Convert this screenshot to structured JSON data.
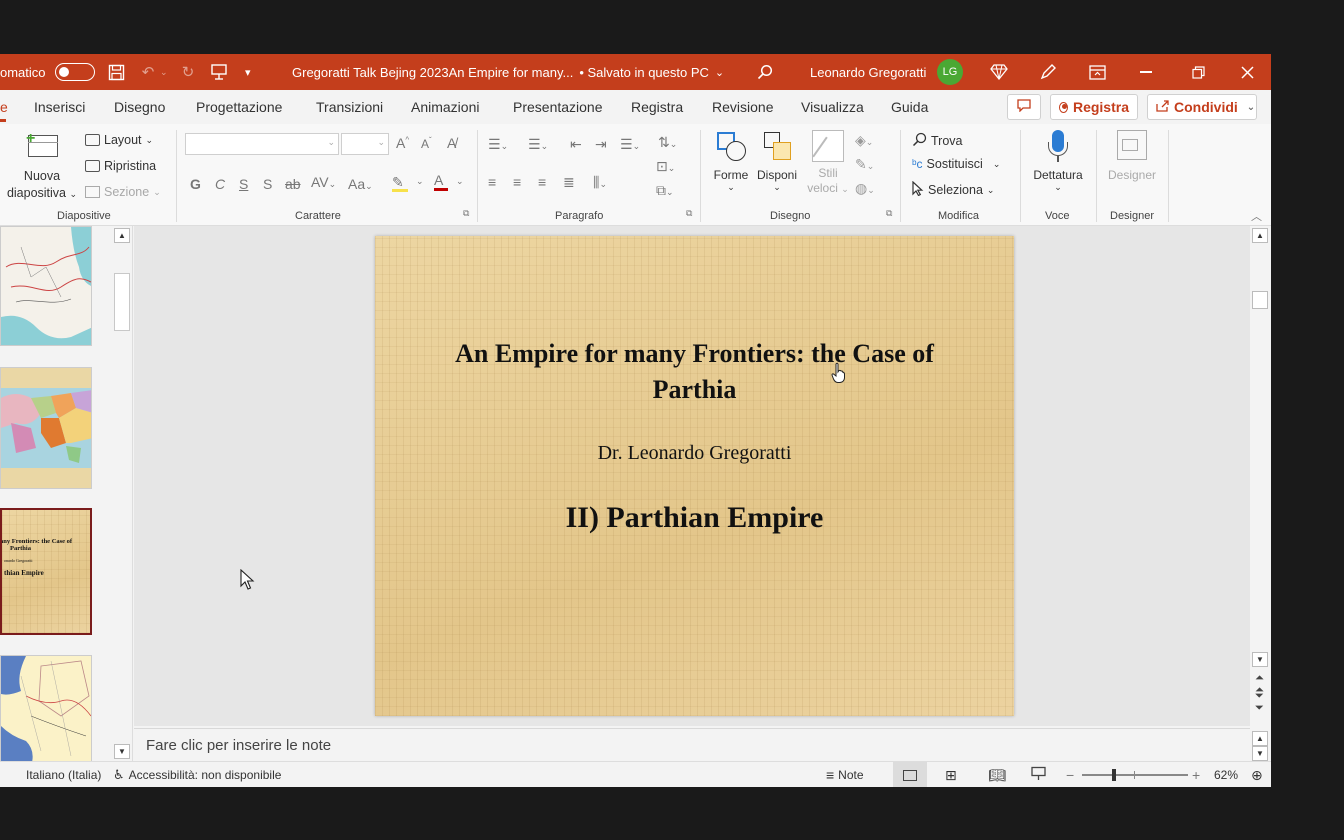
{
  "titlebar": {
    "autosave_label": "omatico",
    "doc_title": "Gregoratti Talk Bejing 2023An Empire for many...",
    "save_status": "• Salvato in questo PC",
    "user_name": "Leonardo Gregoratti",
    "user_initials": "LG",
    "accent_color": "#c43e1c"
  },
  "menu": {
    "tabs": [
      "e",
      "Inserisci",
      "Disegno",
      "Progettazione",
      "Transizioni",
      "Animazioni",
      "Presentazione",
      "Registra",
      "Revisione",
      "Visualizza",
      "Guida"
    ],
    "record_label": "Registra",
    "share_label": "Condividi"
  },
  "ribbon": {
    "diapositive": {
      "label": "Diapositive",
      "new_slide_line1": "Nuova",
      "new_slide_line2": "diapositiva",
      "layout": "Layout",
      "reset": "Ripristina",
      "section": "Sezione"
    },
    "carattere": {
      "label": "Carattere",
      "bold": "G",
      "italic": "C",
      "underline": "S",
      "shadow": "S",
      "spacing": "AV",
      "case": "Aa",
      "font_color": "A"
    },
    "paragrafo": {
      "label": "Paragrafo"
    },
    "disegno": {
      "label": "Disegno",
      "shapes": "Forme",
      "arrange": "Disponi",
      "styles_line1": "Stili",
      "styles_line2": "veloci"
    },
    "modifica": {
      "label": "Modifica",
      "find": "Trova",
      "replace": "Sostituisci",
      "select": "Seleziona"
    },
    "voce": {
      "label": "Voce",
      "dictate": "Dettatura"
    },
    "designer": {
      "label": "Designer",
      "button": "Designer"
    }
  },
  "thumbnails": {
    "slide3_line1": "any Frontiers: the Case of",
    "slide3_line2": "Parthia",
    "slide3_line3": "onardo Gregoratti",
    "slide3_line4": "thian Empire"
  },
  "slide": {
    "title_line1": "An Empire for many Frontiers: the Case of",
    "title_line2": "Parthia",
    "author": "Dr. Leonardo Gregoratti",
    "section": "II) Parthian Empire"
  },
  "notes": {
    "placeholder": "Fare clic per inserire le note"
  },
  "status": {
    "language": "Italiano (Italia)",
    "accessibility": "Accessibilità: non disponibile",
    "notes_button": "Note",
    "zoom_percent": "62%",
    "zoom_level": 0.62
  }
}
